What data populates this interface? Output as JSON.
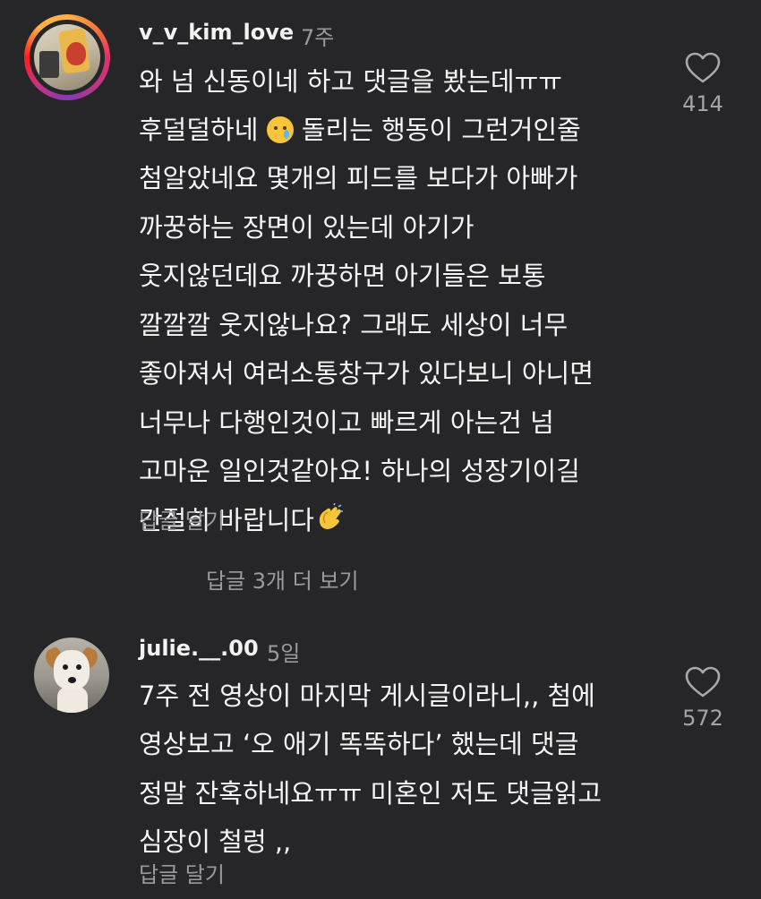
{
  "comments": [
    {
      "username": "v_v_kim_love",
      "time": "7주",
      "lines": [
        "와 넘 신동이네 하고 댓글을 봤는데ㅠㅠ",
        "후덜덜하네 ",
        " 돌리는 행동이 그런거인줄",
        "첨알았네요 몇개의 피드를 보다가 아빠가",
        "까꿍하는 장면이 있는데 아기가",
        "웃지않던데요 까꿍하면 아기들은 보통",
        "깔깔깔 웃지않나요? 그래도 세상이 너무",
        "좋아져서 여러소통창구가 있다보니 아니면",
        "너무나 다행인것이고 빠르게 아는건 넘",
        "고마운 일인것같아요! 하나의 성장기이길",
        "간절히 바랍니다"
      ],
      "emoji_1": "crying-face-emoji",
      "emoji_2": "clapping-hands-emoji",
      "reply_label": "답글 달기",
      "likes": "414",
      "more_replies": "답글 3개 더 보기"
    },
    {
      "username": "julie.__.00",
      "time": "5일",
      "lines": [
        "7주 전 영상이 마지막 게시글이라니,, 첨에",
        "영상보고 ‘오 애기 똑똑하다’ 했는데 댓글",
        "정말 잔혹하네요ㅠㅠ 미혼인 저도 댓글읽고",
        "심장이 철렁 ,,"
      ],
      "reply_label": "답글 달기",
      "likes": "572"
    }
  ],
  "colors": {
    "background": "#262629",
    "text": "#f5f5f5",
    "muted": "#9a9aa0"
  }
}
